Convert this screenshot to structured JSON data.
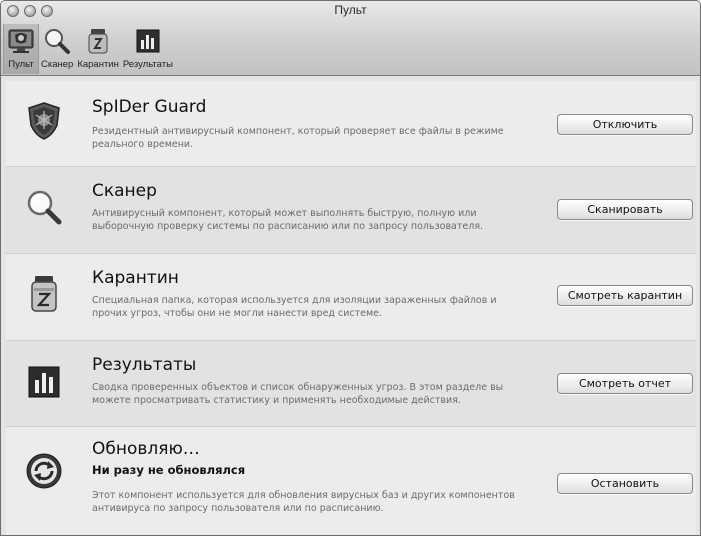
{
  "window": {
    "title": "Пульт"
  },
  "toolbar": {
    "items": [
      {
        "label": "Пульт",
        "icon": "dashboard-icon",
        "active": true
      },
      {
        "label": "Сканер",
        "icon": "magnifier-icon"
      },
      {
        "label": "Карантин",
        "icon": "quarantine-jar-icon"
      },
      {
        "label": "Результаты",
        "icon": "bar-chart-icon"
      }
    ]
  },
  "components": [
    {
      "name": "SpIDer Guard",
      "description": "Резидентный антивирусный компонент, который проверяет все файлы в режиме реального времени.",
      "button": "Отключить",
      "icon": "shield-icon"
    },
    {
      "name": "Сканер",
      "description": "Антивирусный компонент, который может выполнять быструю, полную или выборочную проверку системы по расписанию или по запросу пользователя.",
      "button": "Сканировать",
      "icon": "magnifier-icon"
    },
    {
      "name": "Карантин",
      "description": "Специальная папка, которая используется для изоляции зараженных файлов и прочих угроз, чтобы они не могли нанести вред системе.",
      "button": "Смотреть карантин",
      "icon": "quarantine-jar-icon"
    },
    {
      "name": "Результаты",
      "description": "Сводка проверенных объектов и список обнаруженных угроз. В этом разделе вы можете просматривать статистику и применять необходимые действия.",
      "button": "Смотреть отчет",
      "icon": "bar-chart-icon"
    },
    {
      "name": "Обновляю…",
      "status": "Ни разу не обновлялся",
      "description": "Этот компонент используется для обновления вирусных баз и других компонентов антивируса по запросу пользователя или по расписанию.",
      "button": "Остановить",
      "icon": "update-arrows-icon"
    }
  ]
}
